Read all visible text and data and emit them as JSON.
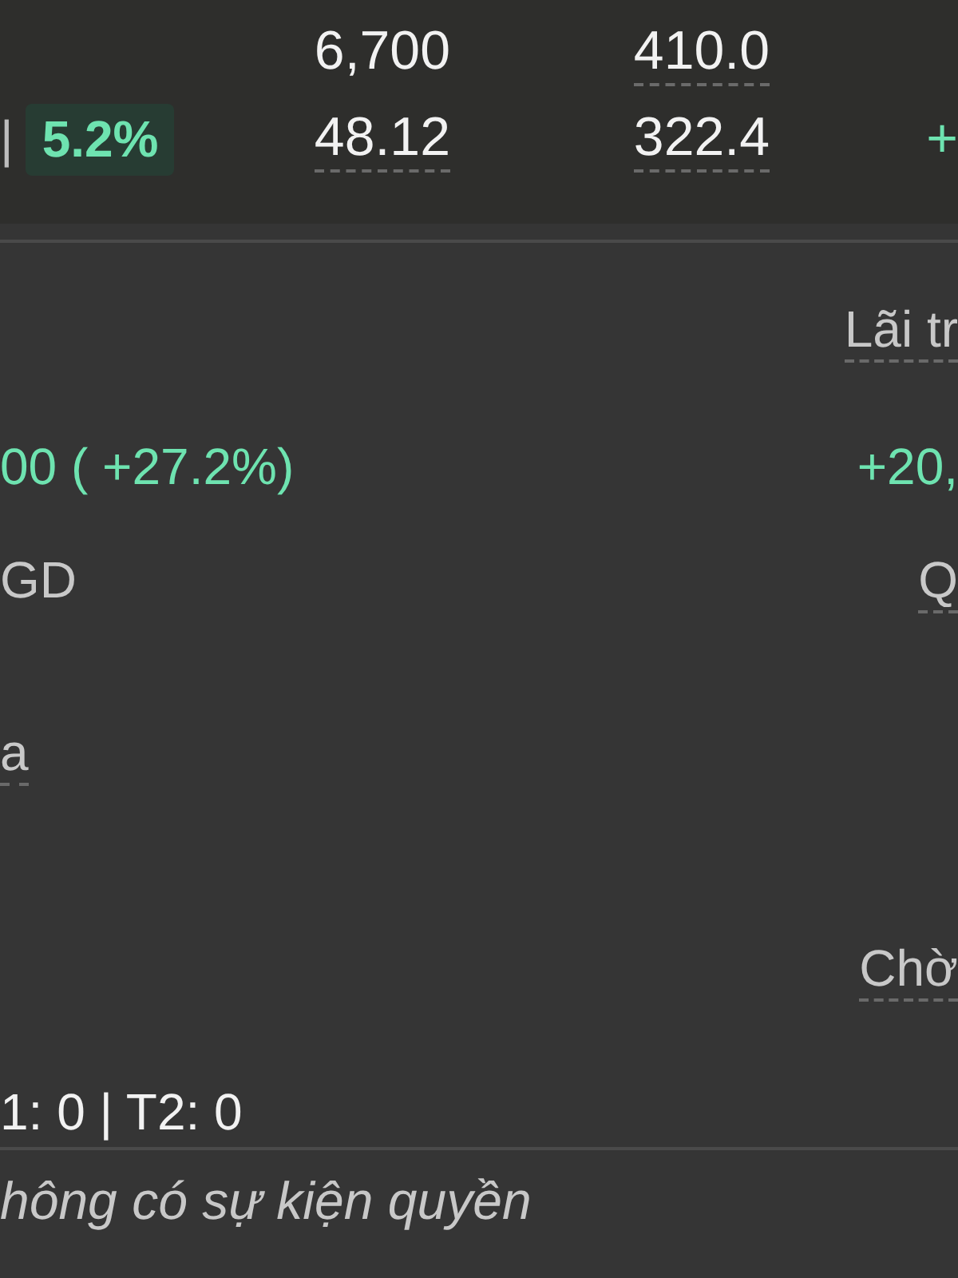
{
  "quote_table": {
    "rows": [
      {
        "change": null,
        "cells": [
          {
            "text": "6,700",
            "underlined": false
          },
          {
            "text": "410.0",
            "underlined": true
          }
        ],
        "trailing": null
      },
      {
        "change": {
          "separator": "|",
          "text": "5.2%"
        },
        "cells": [
          {
            "text": "48.12",
            "underlined": true
          },
          {
            "text": "322.4",
            "underlined": true
          }
        ],
        "trailing": "+"
      }
    ]
  },
  "details": {
    "rows": [
      {
        "left": null,
        "right": {
          "text": "Lãi tr",
          "kind": "label",
          "underlined": true
        }
      },
      {
        "left": {
          "text": "00 ( +27.2%)",
          "kind": "gain",
          "underlined": false
        },
        "right": {
          "text": "+20,",
          "kind": "gain",
          "underlined": false
        }
      },
      {
        "left": {
          "text": "GD",
          "kind": "label",
          "underlined": false
        },
        "right": {
          "text": "Q",
          "kind": "label",
          "underlined": true
        }
      },
      {
        "left": {
          "text": "a",
          "kind": "label",
          "underlined": true
        },
        "right": null
      },
      {
        "left": null,
        "right": {
          "text": "Chờ",
          "kind": "label",
          "underlined": true
        }
      },
      {
        "left": {
          "text": "1: 0 | T2: 0",
          "kind": "value",
          "underlined": false
        },
        "right": null
      }
    ]
  },
  "events": {
    "message": "hông có sự kiện quyền"
  }
}
